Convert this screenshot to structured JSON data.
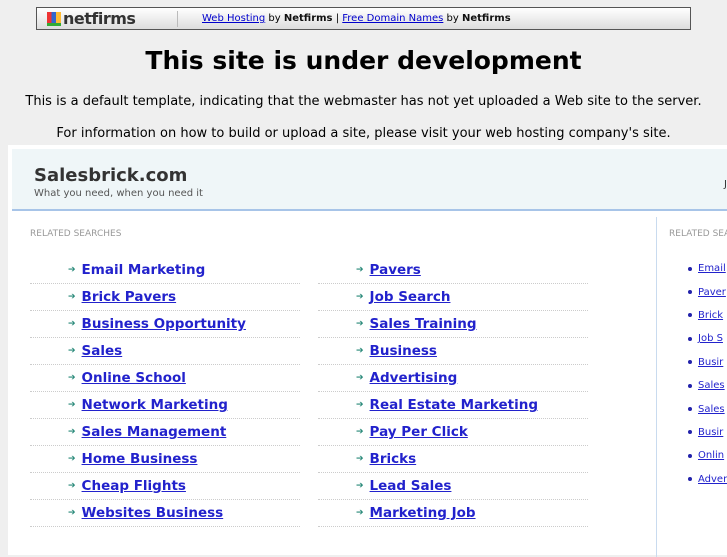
{
  "topbar": {
    "logo": "netfirms",
    "link1": "Web Hosting",
    "by1": "by",
    "brand1": "Netfirms",
    "divider": "|",
    "link2": "Free Domain Names",
    "by2": "by",
    "brand2": "Netfirms"
  },
  "heading": "This site is under development",
  "para1": "This is a default template, indicating that the webmaster has not yet uploaded a Web site to the server.",
  "para2": "For information on how to build or upload a site, please visit your web hosting company's site.",
  "site": {
    "title": "Salesbrick.com",
    "tagline": "What you need, when you need it",
    "right_text": "Ju"
  },
  "related_label": "RELATED SEARCHES",
  "left_col": [
    "Email Marketing",
    "Brick Pavers",
    "Business Opportunity",
    "Sales",
    "Online School",
    "Network Marketing",
    "Sales Management",
    "Home Business",
    "Cheap Flights",
    "Websites Business"
  ],
  "mid_col": [
    "Pavers",
    "Job Search",
    "Sales Training",
    "Business",
    "Advertising",
    "Real Estate Marketing",
    "Pay Per Click",
    "Bricks",
    "Lead Sales",
    "Marketing Job"
  ],
  "right_label": "RELATED SEA",
  "right_col": [
    "Email",
    "Paver",
    "Brick",
    "Job S",
    "Busir",
    "Sales",
    "Sales",
    "Busir",
    "Onlin",
    "Adver"
  ]
}
